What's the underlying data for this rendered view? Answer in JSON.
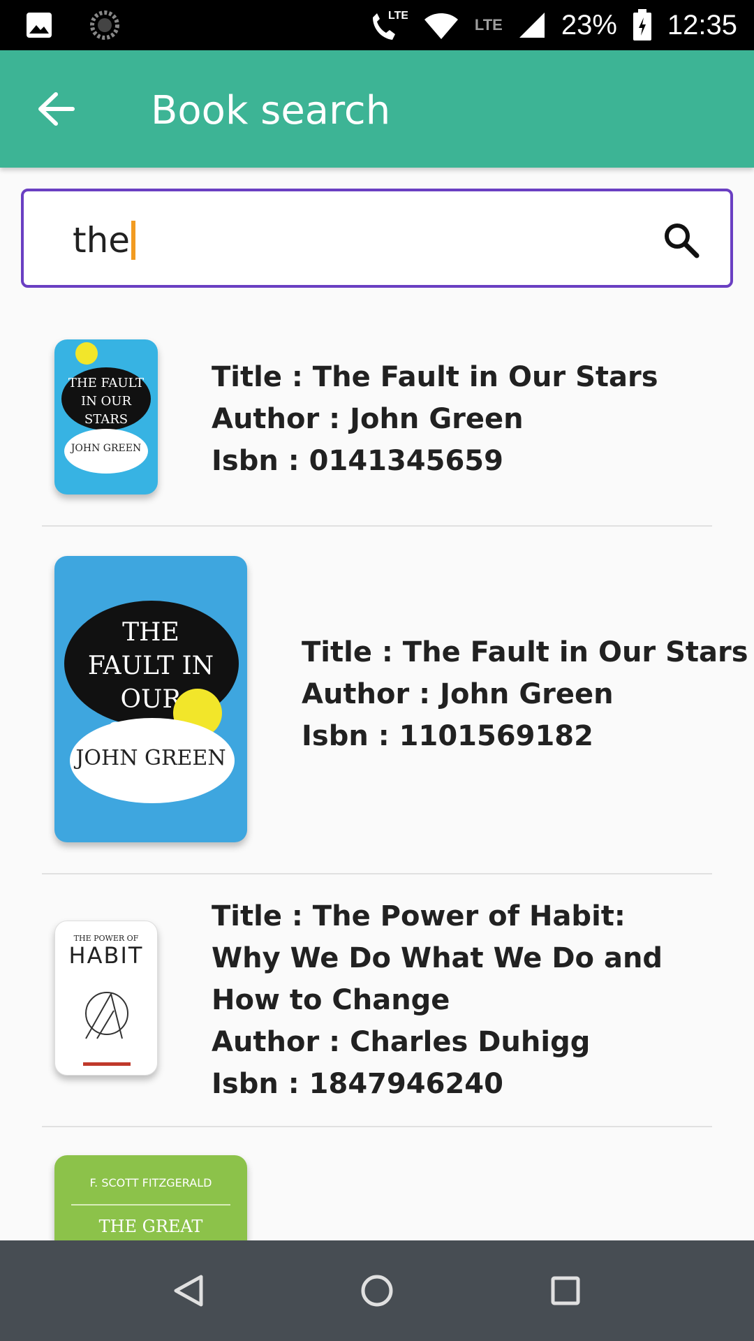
{
  "status_bar": {
    "lte_top": "LTE",
    "lte_label": "LTE",
    "battery": "23%",
    "time": "12:35"
  },
  "app_bar": {
    "title": "Book search"
  },
  "search": {
    "value": "the"
  },
  "books": [
    {
      "title_line": "Title : The Fault in Our Stars",
      "author_line": "Author : John Green",
      "isbn_line": "Isbn : 0141345659",
      "cover_title": "THE FAULT IN OUR STARS",
      "cover_author": "JOHN GREEN"
    },
    {
      "title_line": "Title : The Fault in Our Stars",
      "author_line": "Author : John Green",
      "isbn_line": "Isbn : 1101569182",
      "cover_title": "THE FAULT IN OUR STARS",
      "cover_author": "JOHN GREEN"
    },
    {
      "title_line_1": "Title : The Power of Habit:",
      "title_line_2": "Why We Do What We Do and",
      "title_line_3": "How to Change",
      "author_line": "Author : Charles Duhigg",
      "isbn_line": "Isbn : 1847946240",
      "cover_top": "THE POWER OF",
      "cover_title": "HABIT"
    },
    {
      "cover_author": "F. SCOTT FITZGERALD",
      "cover_title": "THE GREAT"
    }
  ],
  "colors": {
    "app_bar": "#3db495",
    "search_border": "#6a3fc2",
    "caret": "#f29b21",
    "nav_bar": "#474d53"
  }
}
